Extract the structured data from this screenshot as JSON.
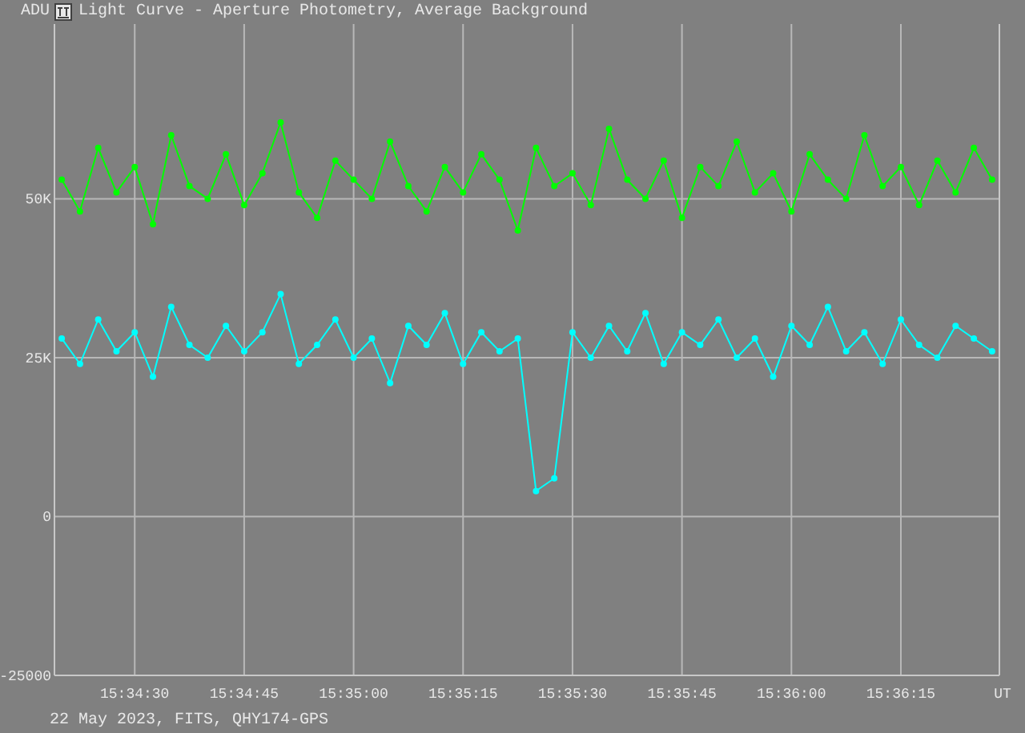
{
  "window": {
    "title": "Light Curve - Aperture Photometry, Average Background"
  },
  "chart": {
    "chart_data": {
      "type": "line",
      "xlabel": "UT",
      "ylabel": "ADU",
      "grid": true,
      "categories": [
        null,
        null,
        null,
        null,
        "15:34:30",
        null,
        null,
        null,
        null,
        null,
        "15:34:45",
        null,
        null,
        null,
        null,
        null,
        "15:35:00",
        null,
        null,
        null,
        null,
        null,
        "15:35:15",
        null,
        null,
        null,
        null,
        null,
        "15:35:30",
        null,
        null,
        null,
        null,
        null,
        "15:35:45",
        null,
        null,
        null,
        null,
        null,
        "15:36:00",
        null,
        null,
        null,
        null,
        null,
        "15:36:15",
        null,
        null,
        null,
        null,
        null
      ],
      "series": [
        {
          "color": "#00ff00",
          "marker": true,
          "values": [
            53000,
            48000,
            58000,
            51000,
            55000,
            46000,
            60000,
            52000,
            50000,
            57000,
            49000,
            54000,
            62000,
            51000,
            47000,
            56000,
            53000,
            50000,
            59000,
            52000,
            48000,
            55000,
            51000,
            57000,
            53000,
            45000,
            58000,
            52000,
            54000,
            49000,
            61000,
            53000,
            50000,
            56000,
            47000,
            55000,
            52000,
            59000,
            51000,
            54000,
            48000,
            57000,
            53000,
            50000,
            60000,
            52000,
            55000,
            49000,
            56000,
            51000,
            58000,
            53000
          ]
        },
        {
          "color": "#00ffff",
          "marker": true,
          "values": [
            28000,
            24000,
            31000,
            26000,
            29000,
            22000,
            33000,
            27000,
            25000,
            30000,
            26000,
            29000,
            35000,
            24000,
            27000,
            31000,
            25000,
            28000,
            21000,
            30000,
            27000,
            32000,
            24000,
            29000,
            26000,
            28000,
            4000,
            6000,
            29000,
            25000,
            30000,
            26000,
            32000,
            24000,
            29000,
            27000,
            31000,
            25000,
            28000,
            22000,
            30000,
            27000,
            33000,
            26000,
            29000,
            24000,
            31000,
            27000,
            25000,
            30000,
            28000,
            26000
          ]
        }
      ],
      "ylim": [
        -25000,
        77500
      ],
      "yticks": [
        {
          "value": -25000,
          "label": "-25000"
        },
        {
          "value": 0,
          "label": "0"
        },
        {
          "value": 25000,
          "label": "25K"
        },
        {
          "value": 50000,
          "label": "50K"
        }
      ]
    }
  },
  "footer": "22 May 2023, FITS, QHY174-GPS"
}
